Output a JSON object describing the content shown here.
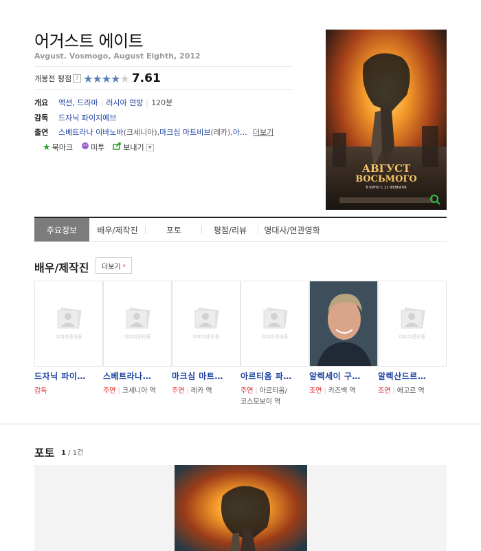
{
  "movie": {
    "title": "어거스트 에이트",
    "subtitle": "Avgust. Vosmogo, August Eighth, 2012",
    "rating_label": "개봉전 평점",
    "rating_help": "?",
    "rating_score": "7.61",
    "rating_stars": 4
  },
  "info": {
    "overview_label": "개요",
    "genre": "액션, 드라마",
    "country": "러시아 연방",
    "runtime": "120분",
    "director_label": "감독",
    "director": "드자닉 파이지예브",
    "cast_label": "출연",
    "cast_line": "스베트라나 이바노바",
    "cast_role1": "(크세니아), ",
    "cast_line2": "마크심 마트비브",
    "cast_role2": "(레카), ",
    "cast_more_name": "아…",
    "cast_more_link": "더보기"
  },
  "actions": {
    "bookmark": "북마크",
    "metoo": "미투",
    "share": "보내기"
  },
  "poster": {
    "title_line1": "АВГУСТ",
    "title_line2": "ВОСЬМОГО",
    "release": "В КИНО С 21 ФЕВРАЛЯ"
  },
  "tabs": [
    "주요정보",
    "배우/제작진",
    "포토",
    "평점/리뷰",
    "명대사/연관영화"
  ],
  "cast_section": {
    "heading": "배우/제작진",
    "more_label": "더보기",
    "placeholder_text": "이미지준비중",
    "people": [
      {
        "name": "드자닉 파이…",
        "role_type": "감독",
        "role": ""
      },
      {
        "name": "스베트라나…",
        "role_type": "주연",
        "role": "크세니아 역"
      },
      {
        "name": "마크심 마트…",
        "role_type": "주연",
        "role": "레카 역"
      },
      {
        "name": "아르티옴 파…",
        "role_type": "주연",
        "role": "아르티옴/",
        "role2": "코스모보이 역"
      },
      {
        "name": "알렉세이 구…",
        "role_type": "조연",
        "role": "카즈백 역"
      },
      {
        "name": "알렉산드르…",
        "role_type": "조연",
        "role": "에고르 역"
      }
    ]
  },
  "photo_section": {
    "heading": "포토",
    "count_current": "1",
    "count_total": "/ 1건"
  },
  "colors": {
    "link": "#1a3fa0",
    "star": "#5b7fb5",
    "role_red": "#e02020",
    "active_tab": "#7c7c7c"
  }
}
